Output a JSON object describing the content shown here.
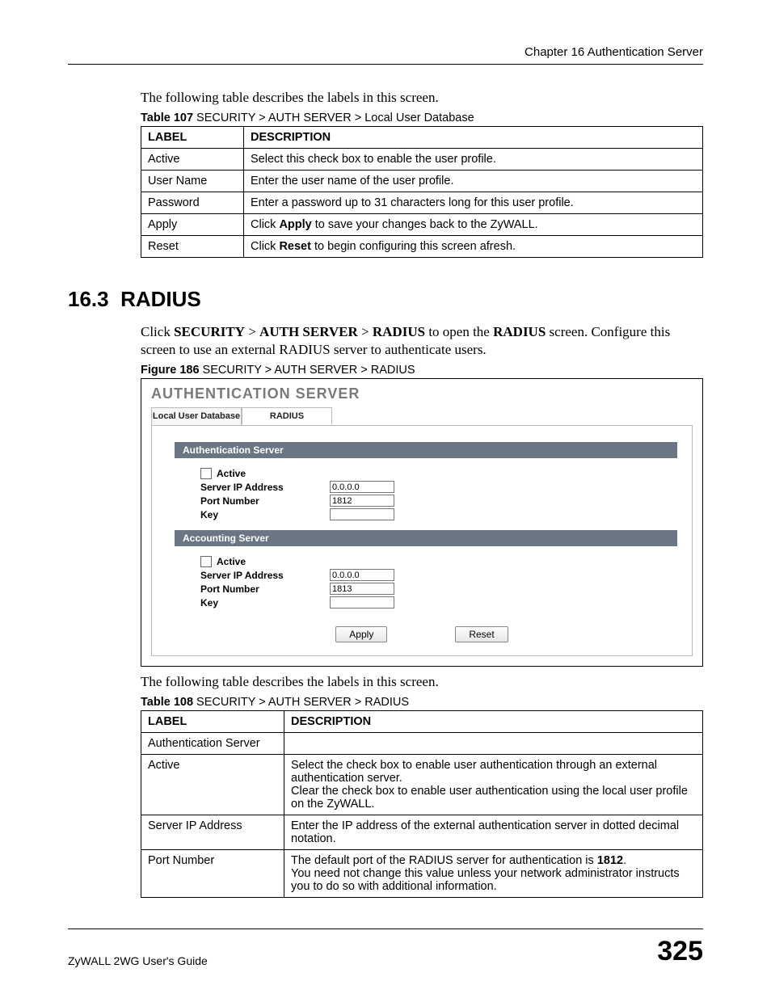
{
  "header": {
    "chapter": "Chapter 16 Authentication Server"
  },
  "intro1": "The following table describes the labels in this screen.",
  "table107": {
    "caption_bold": "Table 107",
    "caption_rest": "   SECURITY > AUTH SERVER > Local User Database",
    "head_label": "Label",
    "head_desc": "Description",
    "rows": [
      {
        "label": "Active",
        "desc": "Select this check box to enable the user profile."
      },
      {
        "label": "User Name",
        "desc": "Enter the user name of the user profile."
      },
      {
        "label": "Password",
        "desc": "Enter a password up to 31 characters long for this user profile."
      },
      {
        "label": "Apply",
        "desc_pre": "Click ",
        "desc_bold": "Apply",
        "desc_post": " to save your changes back to the ZyWALL."
      },
      {
        "label": "Reset",
        "desc_pre": "Click ",
        "desc_bold": "Reset",
        "desc_post": " to begin configuring this screen afresh."
      }
    ]
  },
  "section": {
    "number": "16.3",
    "title": "RADIUS"
  },
  "section_para": {
    "p1a": "Click ",
    "p1b": "SECURITY",
    "p1c": " > ",
    "p1d": "AUTH SERVER",
    "p1e": " > ",
    "p1f": "RADIUS",
    "p1g": " to open the ",
    "p1h": "RADIUS",
    "p1i": " screen. Configure this screen to use an external RADIUS server to authenticate users."
  },
  "figure": {
    "caption_bold": "Figure 186",
    "caption_rest": "   SECURITY > AUTH SERVER > RADIUS",
    "panel_title": "AUTHENTICATION SERVER",
    "tabs": {
      "local": "Local User Database",
      "radius": "RADIUS"
    },
    "auth_server": {
      "bar": "Authentication Server",
      "active": "Active",
      "ip_label": "Server IP Address",
      "ip_value": "0.0.0.0",
      "port_label": "Port Number",
      "port_value": "1812",
      "key_label": "Key",
      "key_value": ""
    },
    "acct_server": {
      "bar": "Accounting Server",
      "active": "Active",
      "ip_label": "Server IP Address",
      "ip_value": "0.0.0.0",
      "port_label": "Port Number",
      "port_value": "1813",
      "key_label": "Key",
      "key_value": ""
    },
    "apply": "Apply",
    "reset": "Reset"
  },
  "intro2": "The following table describes the labels in this screen.",
  "table108": {
    "caption_bold": "Table 108",
    "caption_rest": "   SECURITY > AUTH SERVER > RADIUS",
    "head_label": "Label",
    "head_desc": "Description",
    "rows": {
      "r0": {
        "label": "Authentication Server",
        "desc": ""
      },
      "r1": {
        "label": "Active",
        "p1": "Select the check box to enable user authentication through an external authentication server.",
        "p2": "Clear the check box to enable user authentication using the local user profile on the ZyWALL."
      },
      "r2": {
        "label": "Server IP Address",
        "desc": "Enter the IP address of the external authentication server in dotted decimal notation."
      },
      "r3": {
        "label": "Port Number",
        "p1a": "The default port of the RADIUS server for authentication is ",
        "p1b": "1812",
        "p1c": ".",
        "p2": "You need not change this value unless your network administrator instructs you to do so with additional information."
      }
    }
  },
  "footer": {
    "guide": "ZyWALL 2WG User's Guide",
    "page": "325"
  }
}
